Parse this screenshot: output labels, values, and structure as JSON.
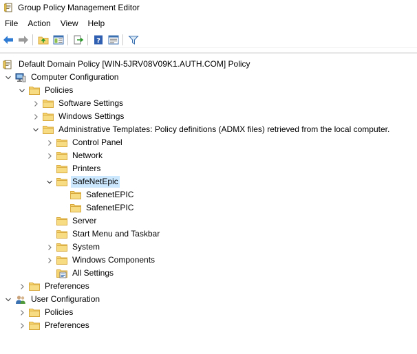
{
  "window": {
    "title": "Group Policy Management Editor",
    "icon": "gpme-icon"
  },
  "menu": {
    "items": [
      "File",
      "Action",
      "View",
      "Help"
    ]
  },
  "toolbar": {
    "buttons": [
      "back-icon",
      "forward-icon",
      "up-folder-icon",
      "show-hide-tree-icon",
      "export-list-icon",
      "help-icon",
      "properties-icon",
      "filter-icon"
    ]
  },
  "tree": {
    "root": "Default Domain Policy [WIN-5JRV08V09K1.AUTH.COM] Policy",
    "computer_config": "Computer Configuration",
    "policies": "Policies",
    "software_settings": "Software Settings",
    "windows_settings": "Windows Settings",
    "admin_templates": "Administrative Templates: Policy definitions (ADMX files) retrieved from the local computer.",
    "control_panel": "Control Panel",
    "network": "Network",
    "printers": "Printers",
    "safenetepic": "SafeNetEpic",
    "safenetepic_child1": "SafenetEPIC",
    "safenetepic_child2": "SafenetEPIC",
    "server": "Server",
    "start_menu": "Start Menu and Taskbar",
    "system": "System",
    "windows_components": "Windows Components",
    "all_settings": "All Settings",
    "cc_preferences": "Preferences",
    "user_config": "User Configuration",
    "uc_policies": "Policies",
    "uc_preferences": "Preferences",
    "selected": "SafeNetEpic"
  },
  "colors": {
    "selection": "#cce8ff",
    "folder": "#f5d36e",
    "folder_edge": "#d8a93c"
  }
}
